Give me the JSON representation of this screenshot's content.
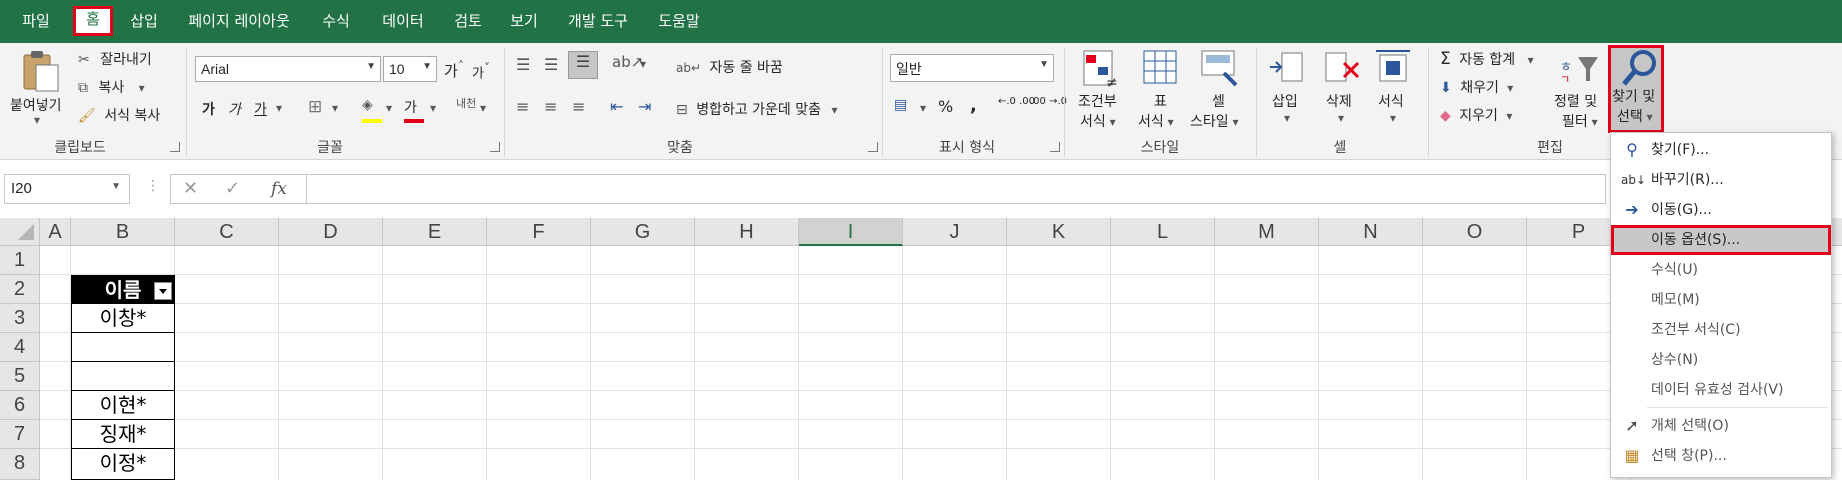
{
  "tabs": [
    {
      "label": "파일",
      "active": false
    },
    {
      "label": "홈",
      "active": true
    },
    {
      "label": "삽입",
      "active": false
    },
    {
      "label": "페이지 레이아웃",
      "active": false
    },
    {
      "label": "수식",
      "active": false
    },
    {
      "label": "데이터",
      "active": false
    },
    {
      "label": "검토",
      "active": false
    },
    {
      "label": "보기",
      "active": false
    },
    {
      "label": "개발 도구",
      "active": false
    },
    {
      "label": "도움말",
      "active": false
    }
  ],
  "clipboard": {
    "paste": "붙여넣기",
    "cut": "잘라내기",
    "copy": "복사",
    "format_painter": "서식 복사",
    "group": "클립보드"
  },
  "font": {
    "name": "Arial",
    "size": "10",
    "grow": "가",
    "shrink": "가",
    "bold": "가",
    "italic": "가",
    "underline": "가",
    "font_color": "가",
    "phonetic": "내천",
    "group": "글꼴"
  },
  "alignment": {
    "wrap_text": "자동 줄 바꿈",
    "merge_center": "병합하고 가운데 맞춤",
    "group": "맞춤"
  },
  "number": {
    "format": "일반",
    "percent": "%",
    "comma": ",",
    "inc_decimal": "←.0 .00",
    "dec_decimal": ".00 →.0",
    "group": "표시 형식"
  },
  "styles": {
    "conditional_line1": "조건부",
    "conditional_line2": "서식",
    "table_line1": "표",
    "table_line2": "서식",
    "cell_line1": "셀",
    "cell_line2": "스타일",
    "group": "스타일"
  },
  "cells": {
    "insert": "삽입",
    "delete": "삭제",
    "format": "서식",
    "group": "셀"
  },
  "editing": {
    "autosum": "자동 합계",
    "fill": "채우기",
    "clear": "지우기",
    "sort_line1": "정렬 및",
    "sort_line2": "필터",
    "find_line1": "찾기 및",
    "find_line2": "선택",
    "group": "편집"
  },
  "formula_bar": {
    "name_box": "I20",
    "fx": "fx",
    "cancel": "✕",
    "enter": "✓",
    "value": ""
  },
  "columns": [
    "A",
    "B",
    "C",
    "D",
    "E",
    "F",
    "G",
    "H",
    "I",
    "J",
    "K",
    "L",
    "M",
    "N",
    "O",
    "P"
  ],
  "selected_column": "I",
  "rows": [
    "1",
    "2",
    "3",
    "4",
    "5",
    "6",
    "7",
    "8"
  ],
  "table": {
    "header": "이름",
    "cells": [
      "이창*",
      "",
      "",
      "이현*",
      "징재*",
      "이정*"
    ]
  },
  "dropdown": {
    "items": [
      {
        "label": "찾기(F)...",
        "icon": "search-icon"
      },
      {
        "label": "바꾸기(R)...",
        "icon": "replace-icon"
      },
      {
        "label": "이동(G)...",
        "icon": "arrow-right-icon"
      },
      {
        "label": "이동 옵션(S)...",
        "icon": "",
        "highlighted": true
      },
      {
        "label": "수식(U)",
        "icon": ""
      },
      {
        "label": "메모(M)",
        "icon": ""
      },
      {
        "label": "조건부 서식(C)",
        "icon": ""
      },
      {
        "label": "상수(N)",
        "icon": ""
      },
      {
        "label": "데이터 유효성 검사(V)",
        "icon": ""
      },
      {
        "label": "개체 선택(O)",
        "icon": "cursor-icon"
      },
      {
        "label": "선택 창(P)...",
        "icon": "selection-pane-icon"
      }
    ]
  },
  "colors": {
    "brand": "#217346",
    "highlight": "#e3001b",
    "accent": "#2b579a"
  }
}
